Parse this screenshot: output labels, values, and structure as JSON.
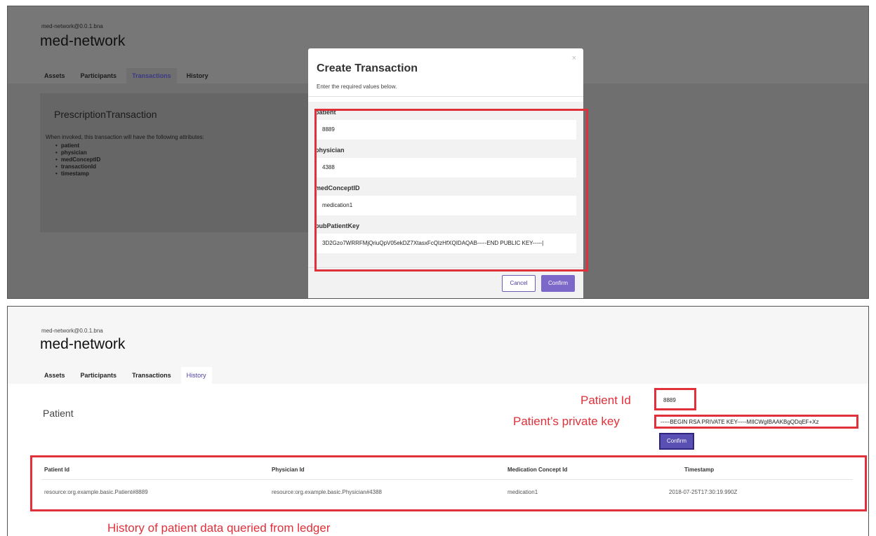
{
  "top_screen": {
    "breadcrumb": "med-network@0.0.1.bna",
    "title": "med-network",
    "tabs": [
      "Assets",
      "Participants",
      "Transactions",
      "History"
    ],
    "active_tab": "Transactions",
    "transaction_card": {
      "name": "PrescriptionTransaction",
      "description": "When invoked, this transaction will have the following attributes:",
      "attributes": [
        "patient",
        "physician",
        "medConceptID",
        "transactionId",
        "timestamp"
      ]
    },
    "modal": {
      "close": "×",
      "title": "Create Transaction",
      "subtitle": "Enter the required values below.",
      "fields": [
        {
          "label": "patient",
          "value": "8889"
        },
        {
          "label": "physician",
          "value": "4388"
        },
        {
          "label": "medConceptID",
          "value": "medication1"
        },
        {
          "label": "pubPatientKey",
          "value": "3D2Gzo7WRRFMjQriuQpV05ekDZ7XtasxFcQIzHfXQIDAQAB-----END PUBLIC KEY-----|"
        }
      ],
      "cancel_label": "Cancel",
      "confirm_label": "Confirm"
    }
  },
  "bottom_screen": {
    "breadcrumb": "med-network@0.0.1.bna",
    "title": "med-network",
    "tabs": [
      "Assets",
      "Participants",
      "Transactions",
      "History"
    ],
    "active_tab": "History",
    "page_title": "Patient",
    "patient_id_annotation": "Patient Id",
    "patient_id_value": "8889",
    "private_key_annotation": "Patient’s private key",
    "private_key_value": "-----BEGIN RSA PRIVATE KEY-----MIICWgIBAAKBgQDqEF+Xz",
    "confirm_label": "Confirm",
    "table": {
      "headers": [
        "Patient Id",
        "Physician Id",
        "Medication Concept Id",
        "Timestamp"
      ],
      "rows": [
        [
          "resource:org.example.basic.Patient#8889",
          "resource:org.example.basic.Physician#4388",
          "medication1",
          "2018-07-25T17:30:19.990Z"
        ]
      ]
    },
    "caption": "History of patient data queried from ledger"
  },
  "colors": {
    "annotation_red": "#e0303a",
    "accent_purple": "#7b68c8",
    "overlay_grey": "#777777"
  }
}
